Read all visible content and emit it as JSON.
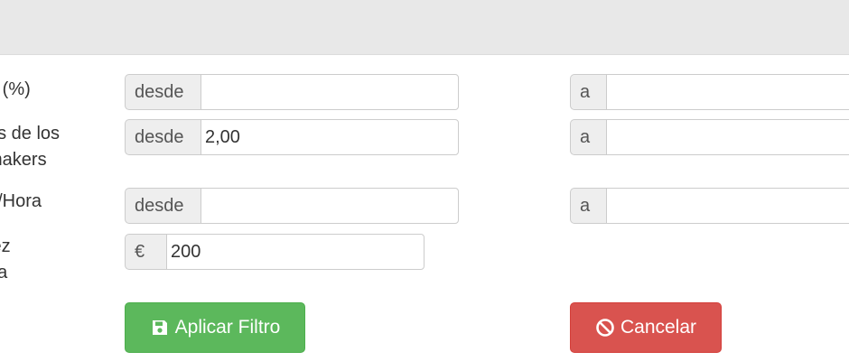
{
  "rows": [
    {
      "label_lines": [
        "g (%)"
      ],
      "from_prefix": "desde",
      "from_value": "",
      "to_prefix": "a",
      "to_value": ""
    },
    {
      "label_lines": [
        "ns de los",
        "makers"
      ],
      "from_prefix": "desde",
      "from_value": "2,00",
      "to_prefix": "a",
      "to_value": ""
    },
    {
      "label_lines": [
        "a/Hora"
      ],
      "from_prefix": "desde",
      "from_value": "",
      "to_prefix": "a",
      "to_value": ""
    },
    {
      "label_lines": [
        "lez",
        "na"
      ],
      "currency_prefix": "€",
      "value": "200"
    }
  ],
  "buttons": {
    "apply_label": "Aplicar Filtro",
    "cancel_label": "Cancelar"
  },
  "colors": {
    "apply": "#5cb85c",
    "cancel": "#d9534f",
    "header_bar": "#e8e8e8"
  },
  "icons": {
    "apply": "floppy-disk-icon",
    "cancel": "ban-icon"
  }
}
